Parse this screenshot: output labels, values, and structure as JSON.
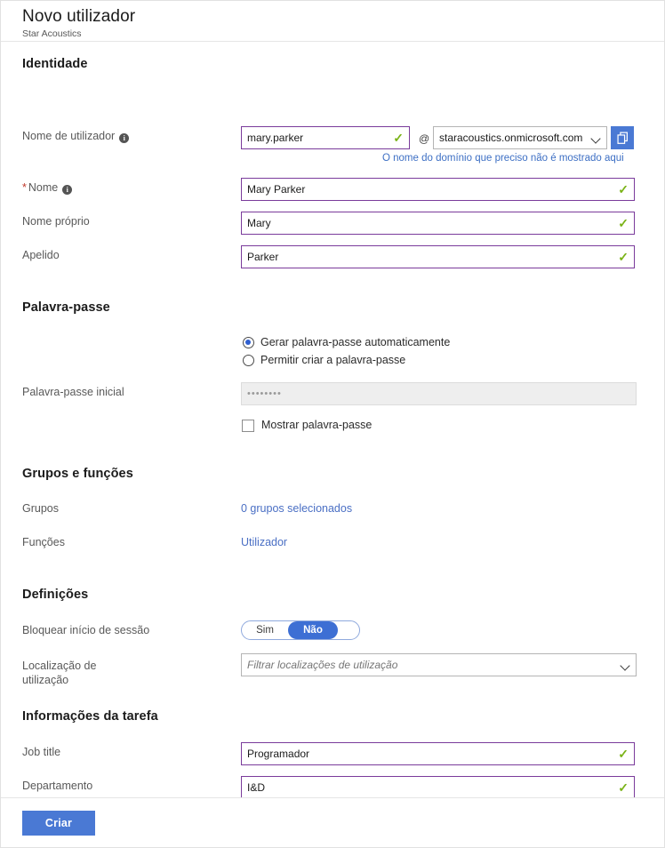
{
  "header": {
    "title": "Novo utilizador",
    "subtitle": "Star Acoustics"
  },
  "sections": {
    "identity": {
      "title": "Identidade",
      "username": {
        "label": "Nome de utilizador",
        "info_icon": "info-icon",
        "value": "mary.parker",
        "valid_icon": "check-icon",
        "at": "@",
        "domain": "staracoustics.onmicrosoft.com",
        "chevron_icon": "chevron-down-icon",
        "copy_icon": "copy-icon",
        "hint": "O nome do domínio que preciso não é mostrado aqui"
      },
      "name": {
        "required_marker": "*",
        "label": "Nome",
        "info_icon": "info-icon",
        "value": "Mary Parker",
        "valid_icon": "check-icon"
      },
      "first_name": {
        "label": "Nome próprio",
        "value": "Mary",
        "valid_icon": "check-icon"
      },
      "last_name": {
        "label": "Apelido",
        "value": "Parker",
        "valid_icon": "check-icon"
      }
    },
    "password": {
      "title": "Palavra-passe",
      "option_auto": "Gerar palavra-passe automaticamente",
      "option_manual": "Permitir criar a palavra-passe",
      "selected_option": "auto",
      "initial_label": "Palavra-passe inicial",
      "initial_value": "••••••••",
      "show_password_label": "Mostrar palavra-passe",
      "show_password_checked": false
    },
    "groups": {
      "title": "Grupos e funções",
      "groups_label": "Grupos",
      "groups_value": "0 grupos selecionados",
      "roles_label": "Funções",
      "roles_value": "Utilizador"
    },
    "settings": {
      "title": "Definições",
      "block_signin_label": "Bloquear início de sessão",
      "toggle_yes": "Sim",
      "toggle_no": "Não",
      "toggle_selected": "Não",
      "location_label": "Localização de utilização",
      "location_placeholder": "Filtrar localizações de utilização",
      "chevron_icon": "chevron-down-icon"
    },
    "job": {
      "title": "Informações da tarefa",
      "job_title_label": "Job title",
      "job_title_value": "Programador",
      "department_label": "Departamento",
      "department_value": "I&D",
      "valid_icon": "check-icon"
    }
  },
  "footer": {
    "create_label": "Criar"
  },
  "colors": {
    "accent_blue": "#4a79d4",
    "focus_purple": "#7a3b9b",
    "valid_green": "#7ab317",
    "link_blue": "#4a6fc4",
    "radio_blue": "#2f5fd0"
  }
}
